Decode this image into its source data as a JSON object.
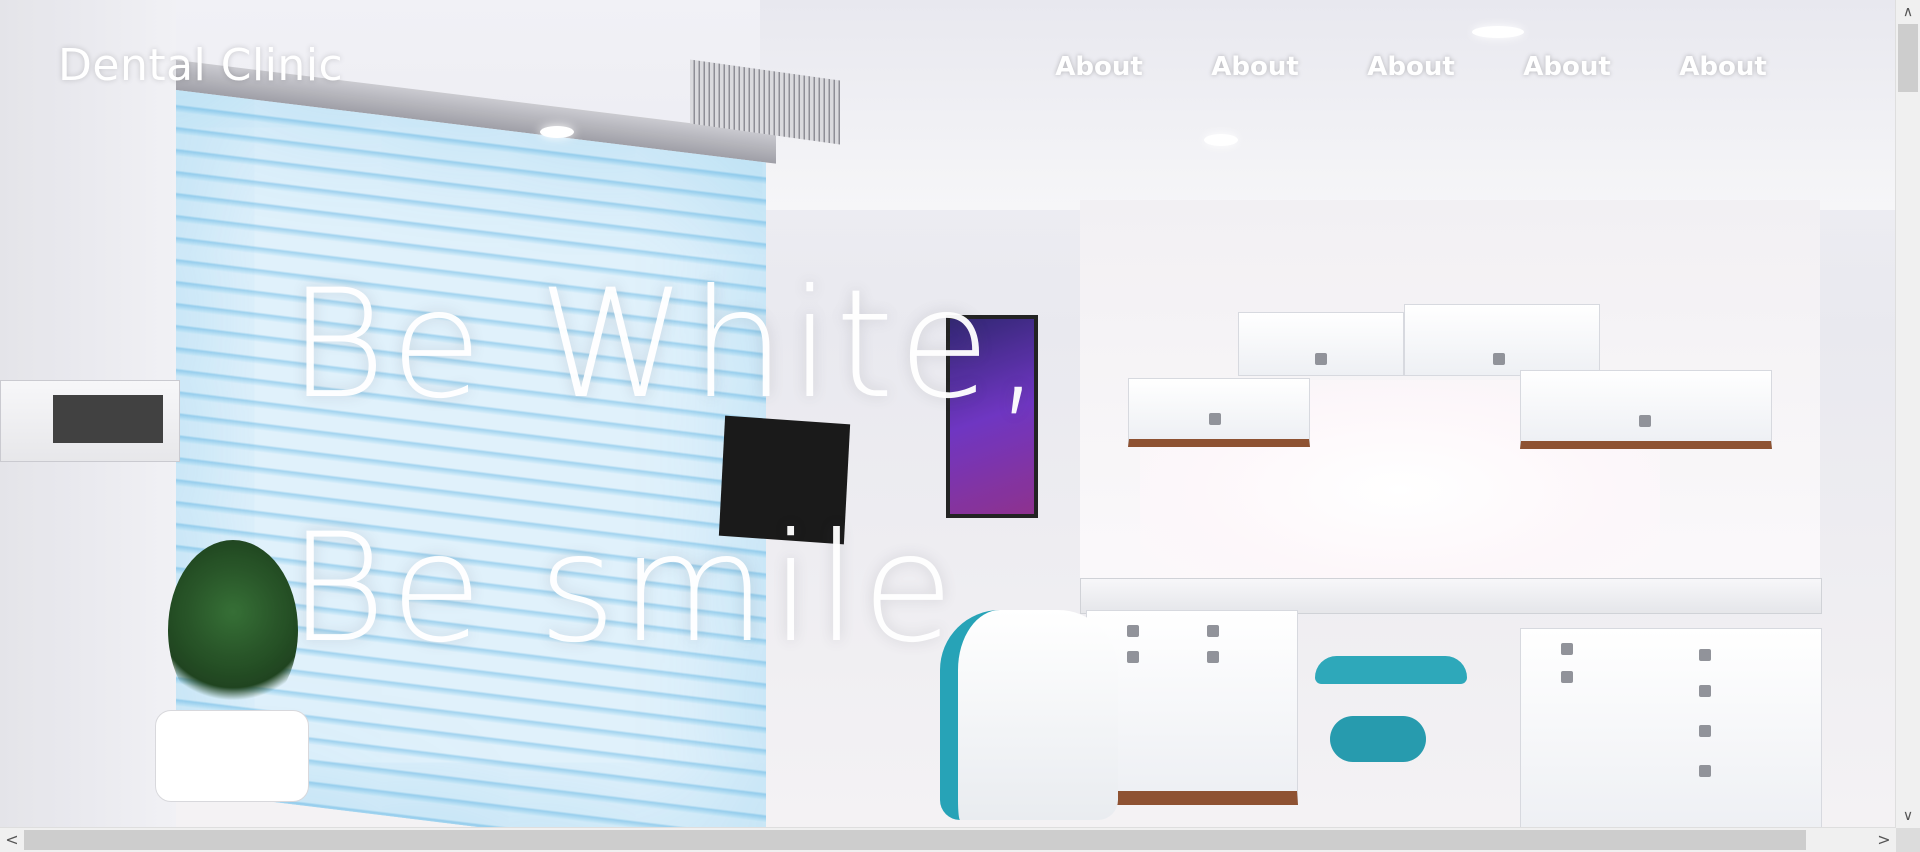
{
  "header": {
    "brand": "Dental Clinic",
    "nav": [
      "About",
      "About",
      "About",
      "About",
      "About"
    ]
  },
  "hero": {
    "line1": "Be White,",
    "line2": "Be smile"
  },
  "scrollbars": {
    "up_arrow": "∨",
    "down_arrow": "∨",
    "left_arrow": "<",
    "right_arrow": ">"
  }
}
